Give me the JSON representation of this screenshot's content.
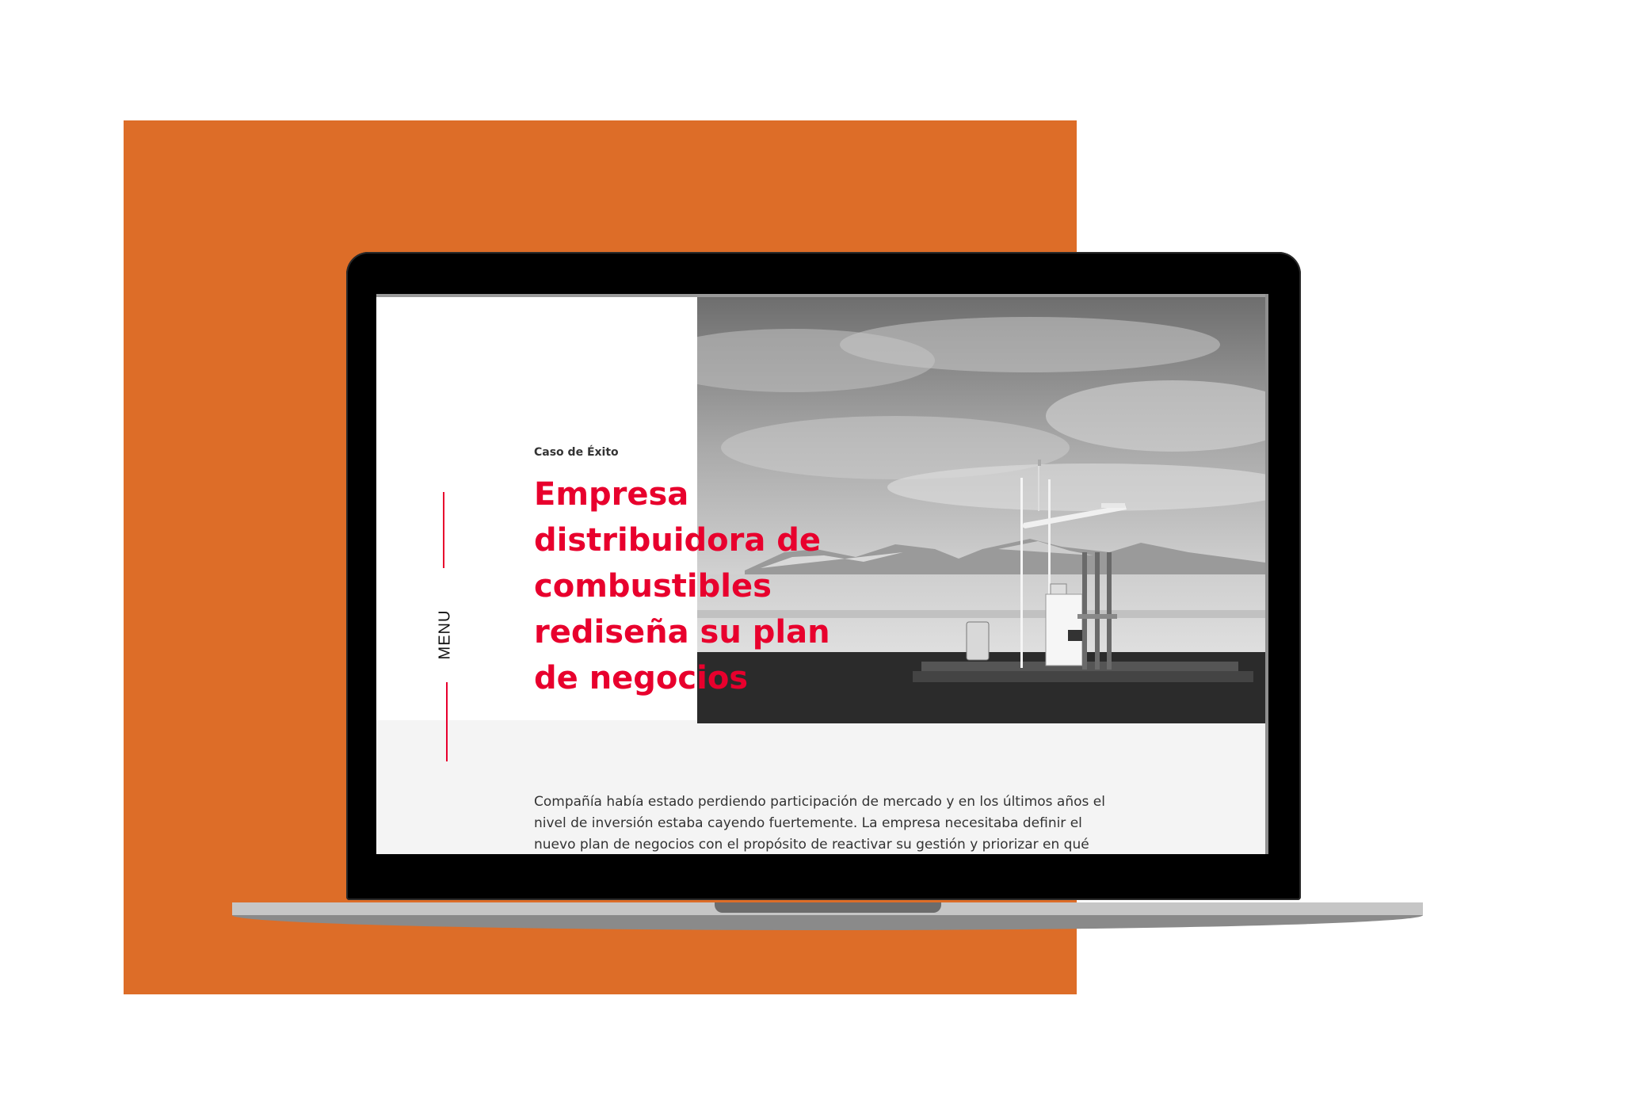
{
  "page": {
    "menu_label": "MENU",
    "eyebrow": "Caso de Éxito",
    "headline_lines": [
      "Empresa",
      "distribuidora de",
      "combustibles",
      "rediseña su plan",
      "de negocios"
    ],
    "body_lines": [
      "Compañía había estado perdiendo participación de mercado y en los últimos años el",
      "nivel de inversión estaba cayendo fuertemente. La empresa necesitaba definir el",
      "nuevo plan de negocios con el propósito de reactivar su gestión y priorizar en qué"
    ]
  },
  "colors": {
    "accent": "#e8002d",
    "backdrop": "#dd6d28",
    "body_text": "#333333"
  },
  "icons": {
    "hero_image": "gas-station-photo"
  }
}
